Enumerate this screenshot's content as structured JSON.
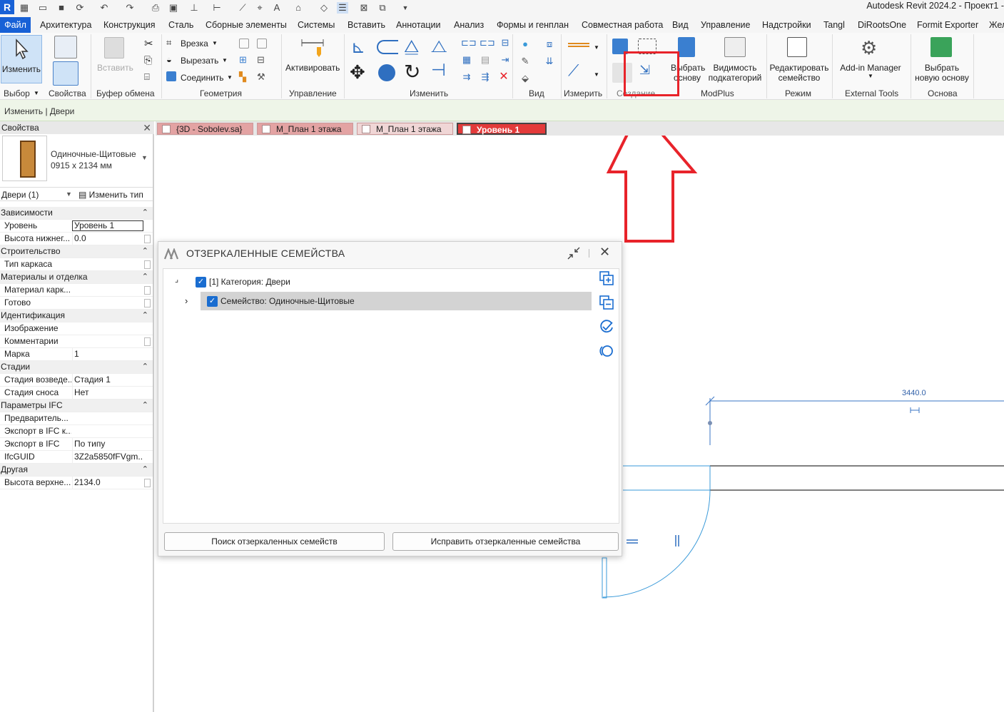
{
  "app": {
    "title": "Autodesk Revit 2024.2 - Проект1 -",
    "logo_letter": "R"
  },
  "menu": {
    "file": "Файл",
    "tabs": [
      "Архитектура",
      "Конструкция",
      "Сталь",
      "Сборные элементы",
      "Системы",
      "Вставить",
      "Аннотации",
      "Анализ",
      "Формы и генплан",
      "Совместная работа",
      "Вид",
      "Управление",
      "Надстройки",
      "Tangl",
      "DiRootsOne",
      "Formit Exporter",
      "Жел"
    ]
  },
  "ribbon": {
    "modify_label": "Изменить",
    "insert_label": "Вставить",
    "activate_label": "Активировать",
    "cut_label": "Врезка",
    "cut2_label": "Вырезать",
    "join_label": "Соединить",
    "select_base_label": "Выбрать основу",
    "select_base_l1": "Выбрать",
    "select_base_l2": "основу",
    "visibility_l1": "Видимость",
    "visibility_l2": "подкатегорий",
    "edit_family_l1": "Редактировать",
    "edit_family_l2": "семейство",
    "addin_manager": "Add-in Manager",
    "new_base_l1": "Выбрать",
    "new_base_l2": "новую основу",
    "panels": [
      "Выбор",
      "Свойства",
      "Буфер обмена",
      "Геометрия",
      "Управление",
      "Изменить",
      "Вид",
      "Измерить",
      "Создание",
      "ModPlus",
      "Режим",
      "External Tools",
      "Основа"
    ]
  },
  "context": {
    "label": "Изменить | Двери"
  },
  "properties": {
    "title": "Свойства",
    "type_name_l1": "Одиночные-Щитовые",
    "type_name_l2": "0915 x 2134 мм",
    "filter": "Двери (1)",
    "edit_type": "Изменить тип",
    "rows": [
      {
        "cat": "Зависимости"
      },
      {
        "name": "Уровень",
        "value": "Уровень 1",
        "edit": true
      },
      {
        "name": "Высота нижнег...",
        "value": "0.0",
        "chk": true
      },
      {
        "cat": "Строительство"
      },
      {
        "name": "Тип каркаса",
        "value": "",
        "chk": true
      },
      {
        "cat": "Материалы и отделка"
      },
      {
        "name": "Материал карк...",
        "value": "",
        "chk": true
      },
      {
        "name": "Готово",
        "value": "",
        "chk": true
      },
      {
        "cat": "Идентификация"
      },
      {
        "name": "Изображение",
        "value": ""
      },
      {
        "name": "Комментарии",
        "value": "",
        "chk": true
      },
      {
        "name": "Марка",
        "value": "1"
      },
      {
        "cat": "Стадии"
      },
      {
        "name": "Стадия возведе...",
        "value": "Стадия 1"
      },
      {
        "name": "Стадия сноса",
        "value": "Нет"
      },
      {
        "cat": "Параметры IFC"
      },
      {
        "name": "Предваритель...",
        "value": ""
      },
      {
        "name": "Экспорт в IFC к...",
        "value": ""
      },
      {
        "name": "Экспорт в IFC",
        "value": "По типу"
      },
      {
        "name": "IfcGUID",
        "value": "3Z2a5850fFVgm..."
      },
      {
        "cat": "Другая"
      },
      {
        "name": "Высота верхне...",
        "value": "2134.0",
        "chk": true
      }
    ]
  },
  "viewtabs": [
    "{3D - Sobolev.sa}",
    "М_План 1 этажа",
    "М_План 1 этажа",
    "Уровень 1"
  ],
  "canvas": {
    "dimension": "3440.0"
  },
  "dialog": {
    "title": "ОТЗЕРКАЛЕННЫЕ СЕМЕЙСТВА",
    "category": "[1] Категория: Двери",
    "family": "Семейство: Одиночные-Щитовые",
    "search_button": "Поиск отзеркаленных семейств",
    "fix_button": "Исправить отзеркаленные семейства"
  },
  "colors": {
    "accent": "#1861d6",
    "highlight": "#e8232a",
    "checkbox": "#1a6dd0"
  }
}
